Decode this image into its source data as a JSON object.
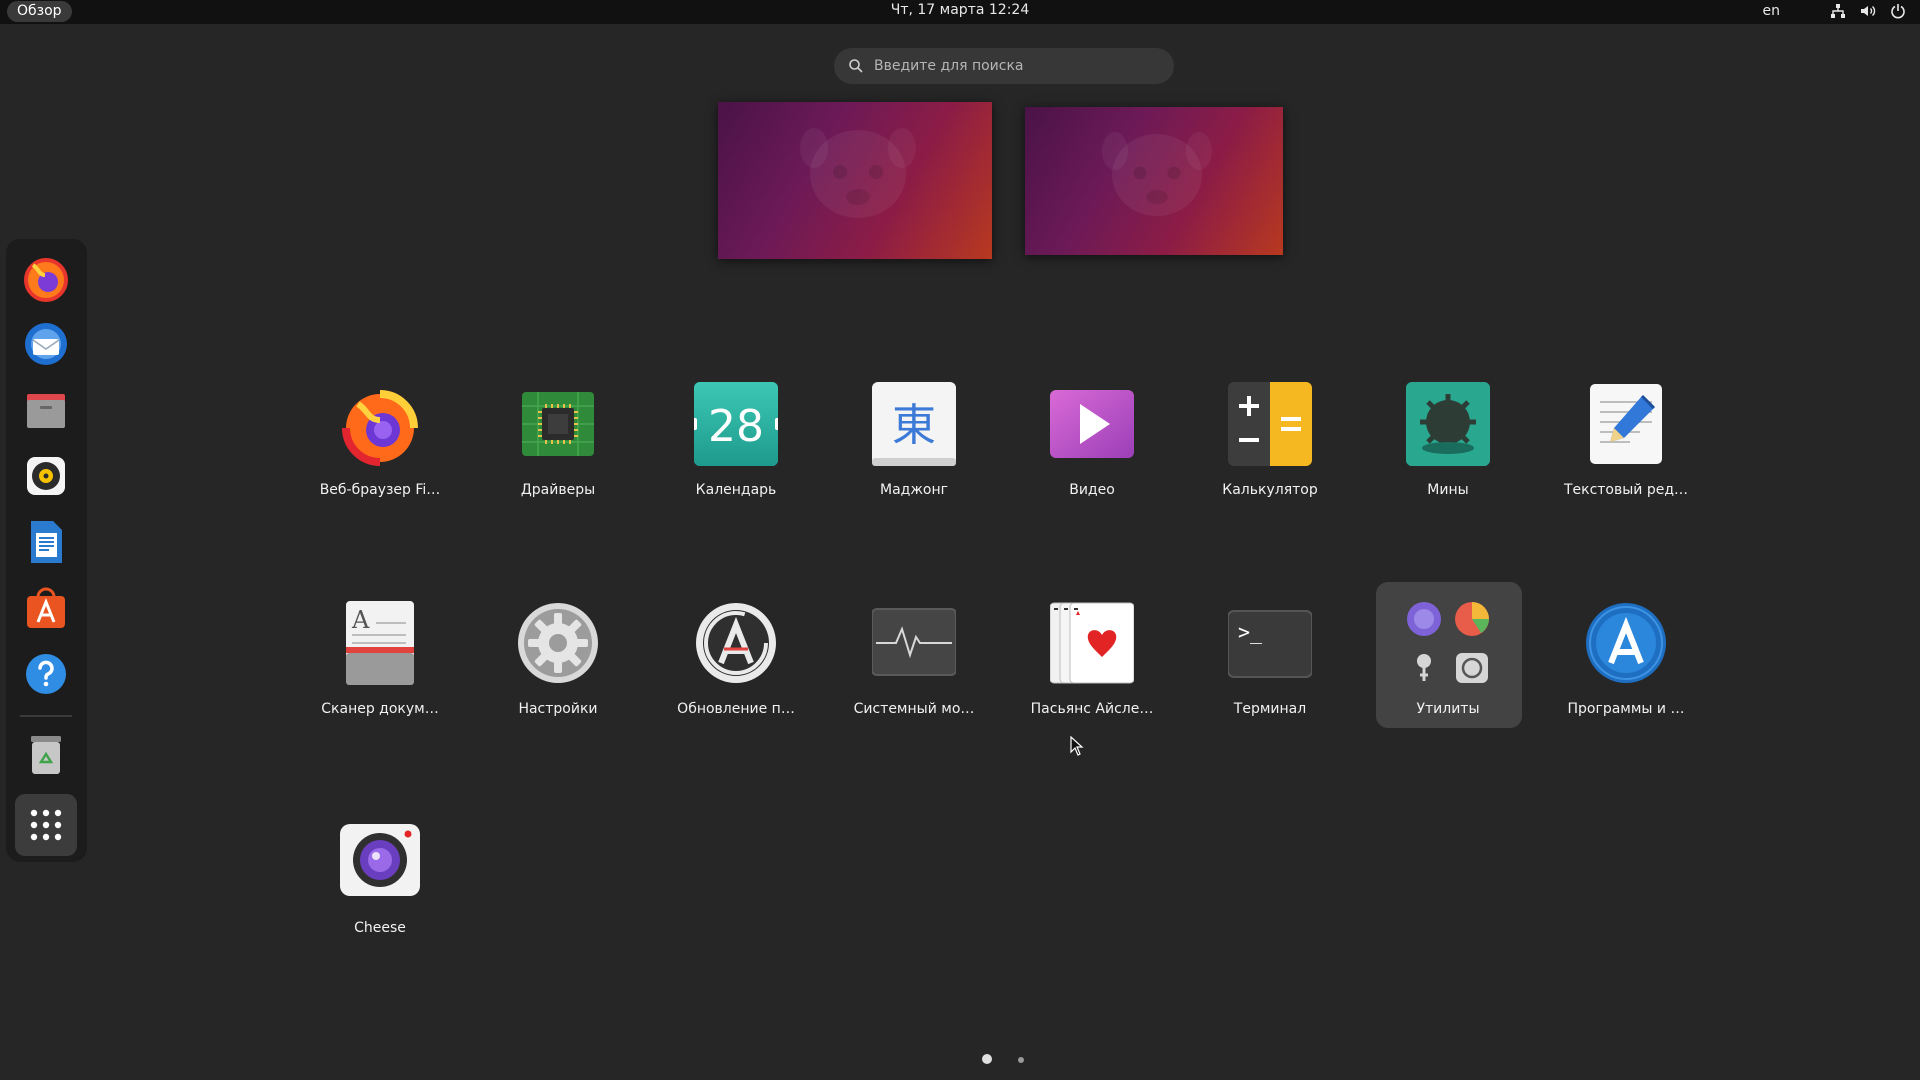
{
  "topbar": {
    "activities": "Обзор",
    "clock": "Чт, 17 марта  12:24",
    "lang": "en",
    "icons": [
      "network-icon",
      "volume-icon",
      "power-icon"
    ]
  },
  "search": {
    "placeholder": "Введите для поиска",
    "value": ""
  },
  "workspaces": [
    "workspace-1",
    "workspace-2"
  ],
  "dock": {
    "items": [
      "firefox",
      "thunderbird",
      "files",
      "rhythmbox",
      "libreoffice-writer",
      "ubuntu-software",
      "help",
      "trash",
      "show-applications"
    ]
  },
  "apps": [
    {
      "id": "firefox",
      "label": "Веб-браузер Fi…"
    },
    {
      "id": "drivers",
      "label": "Драйверы"
    },
    {
      "id": "calendar",
      "label": "Календарь",
      "icon_text": "28"
    },
    {
      "id": "mahjongg",
      "label": "Маджонг",
      "icon_text": "東"
    },
    {
      "id": "videos",
      "label": "Видео"
    },
    {
      "id": "calculator",
      "label": "Калькулятор"
    },
    {
      "id": "mines",
      "label": "Мины"
    },
    {
      "id": "text-editor",
      "label": "Текстовый ред…"
    },
    {
      "id": "document-scanner",
      "label": "Сканер докум…",
      "icon_text": "A"
    },
    {
      "id": "settings",
      "label": "Настройки"
    },
    {
      "id": "software-updater",
      "label": "Обновление п…"
    },
    {
      "id": "system-monitor",
      "label": "Системный мо…"
    },
    {
      "id": "aisleriot",
      "label": "Пасьянс Айсле…"
    },
    {
      "id": "terminal",
      "label": "Терминал",
      "icon_text": ">_"
    },
    {
      "id": "utilities-folder",
      "label": "Утилиты"
    },
    {
      "id": "software-and-updates",
      "label": "Программы и …"
    },
    {
      "id": "cheese",
      "label": "Cheese"
    }
  ],
  "pages": {
    "count": 2,
    "current": 1
  },
  "colors": {
    "background": "#262626",
    "topbar": "#111111",
    "dock": "#1c1c1c",
    "folder_highlight": "#434343",
    "ubuntu_orange": "#e95420"
  }
}
